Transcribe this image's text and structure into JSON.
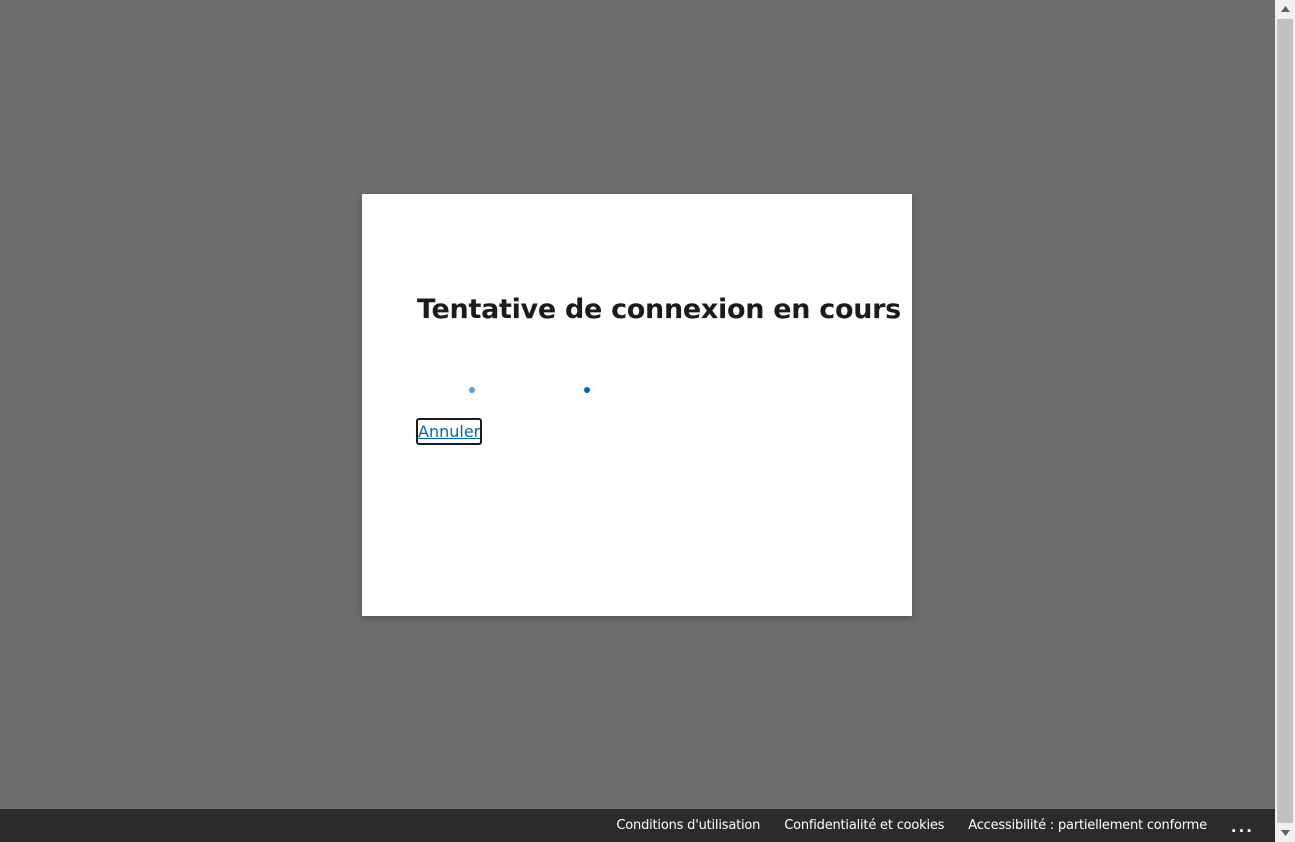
{
  "dialog": {
    "title": "Tentative de connexion en cours",
    "cancel_label": "Annuler"
  },
  "progress": {
    "dot_color_light": "#5ea0d6",
    "dot_color_dark": "#0067b8"
  },
  "footer": {
    "links": [
      {
        "label": "Conditions d'utilisation"
      },
      {
        "label": "Confidentialité et cookies"
      },
      {
        "label": "Accessibilité : partiellement conforme"
      }
    ],
    "more_label": "..."
  },
  "colors": {
    "backdrop": "#6d6d6d",
    "link": "#0067b8",
    "footer_bg": "#2b2b2b"
  },
  "icons": {
    "more": "more-icon",
    "scroll_up": "scroll-up-icon",
    "scroll_down": "scroll-down-icon"
  }
}
